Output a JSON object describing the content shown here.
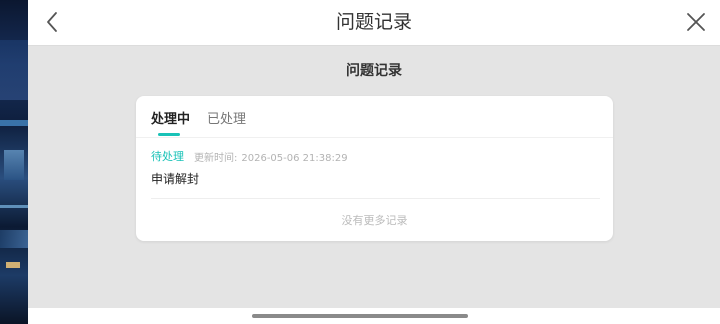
{
  "header": {
    "title": "问题记录",
    "back_icon": "chevron-left-icon",
    "close_icon": "close-icon"
  },
  "section": {
    "title": "问题记录"
  },
  "tabs": [
    {
      "label": "处理中",
      "active": true
    },
    {
      "label": "已处理",
      "active": false
    }
  ],
  "records": [
    {
      "status": "待处理",
      "updated_label": "更新时间:",
      "updated_time": "2026-05-06 21:38:29",
      "title": "申请解封"
    }
  ],
  "footer": {
    "no_more": "没有更多记录"
  },
  "colors": {
    "accent": "#19c2b7",
    "background": "#e4e4e4",
    "card": "#ffffff"
  }
}
